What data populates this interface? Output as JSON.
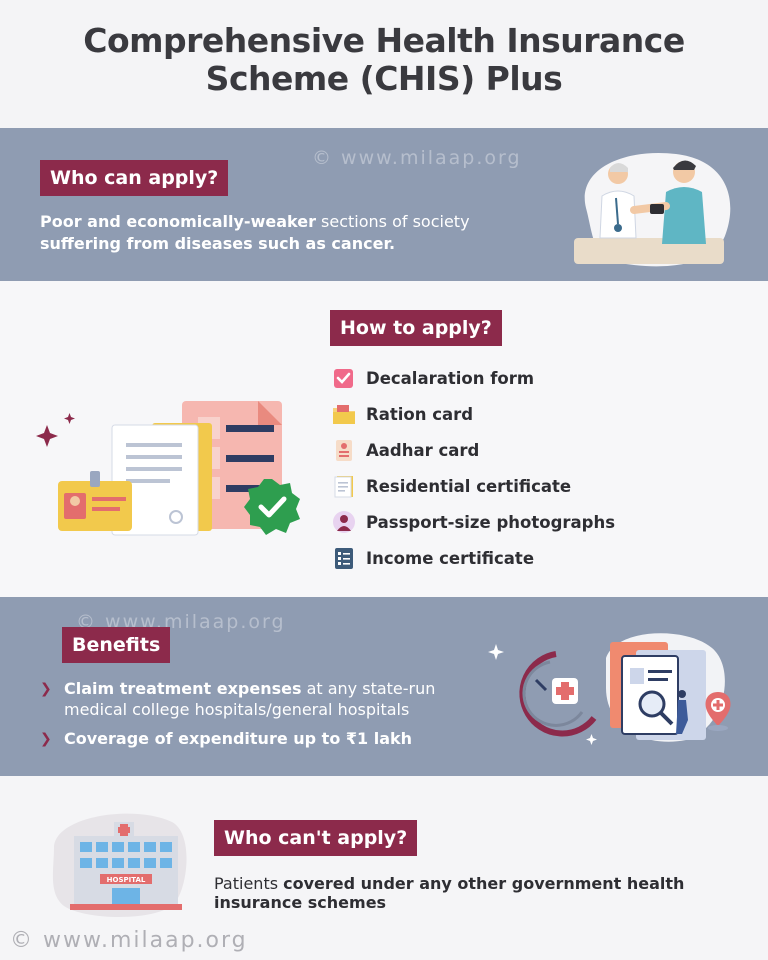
{
  "title": {
    "line1": "Comprehensive Health Insurance",
    "line2": "Scheme (CHIS) Plus"
  },
  "watermark": "© www.milaap.org",
  "who_can_apply": {
    "heading": "Who can apply?",
    "bold1": "Poor and economically-weaker",
    "normal1": " sections of society",
    "bold2": "suffering from diseases such as cancer."
  },
  "how_to_apply": {
    "heading": "How to apply?",
    "items": [
      {
        "label": "Decalaration form",
        "icon": "checkbox-icon"
      },
      {
        "label": "Ration card",
        "icon": "folder-icon"
      },
      {
        "label": "Aadhar card",
        "icon": "id-card-icon"
      },
      {
        "label": "Residential certificate",
        "icon": "document-icon"
      },
      {
        "label": "Passport-size photographs",
        "icon": "person-photo-icon"
      },
      {
        "label": "Income certificate",
        "icon": "checklist-icon"
      }
    ]
  },
  "benefits": {
    "heading": "Benefits",
    "item1_bold": "Claim treatment expenses",
    "item1_rest": " at any state-run",
    "item1_line2": "medical college hospitals/general hospitals",
    "item2_bold": "Coverage of expenditure up to ₹1 lakh"
  },
  "who_cant_apply": {
    "heading": "Who can't apply?",
    "normal": "Patients ",
    "bold1": "covered under any other government health",
    "bold2": "insurance schemes"
  },
  "hospital_sign": "HOSPITAL",
  "colors": {
    "accent": "#8c2a4b",
    "band": "#8f9cb2",
    "background": "#f4f4f6"
  }
}
